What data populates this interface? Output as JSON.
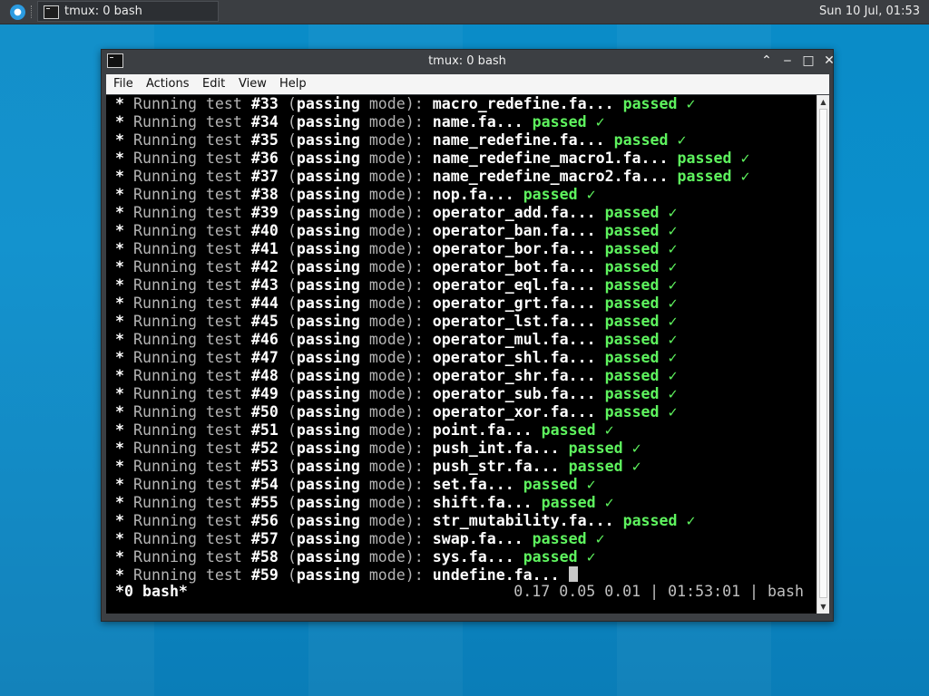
{
  "panel": {
    "task_label": "tmux: 0 bash",
    "clock": "Sun 10 Jul, 01:53",
    "logo_icon": "xfce-mouse-icon"
  },
  "window": {
    "title": "tmux: 0 bash",
    "menu": [
      "File",
      "Actions",
      "Edit",
      "View",
      "Help"
    ],
    "controls": [
      "⌃",
      "‒",
      "□",
      "✕"
    ]
  },
  "terminal": {
    "prefix": "Running test",
    "mode_open": "(",
    "mode_word1": "passing",
    "mode_word2": "mode",
    "mode_close": "):",
    "result": "passed",
    "check": "✓",
    "lines": [
      {
        "num": "#33",
        "file": "macro_redefine.fa...",
        "passed": true
      },
      {
        "num": "#34",
        "file": "name.fa...",
        "passed": true
      },
      {
        "num": "#35",
        "file": "name_redefine.fa...",
        "passed": true
      },
      {
        "num": "#36",
        "file": "name_redefine_macro1.fa...",
        "passed": true
      },
      {
        "num": "#37",
        "file": "name_redefine_macro2.fa...",
        "passed": true
      },
      {
        "num": "#38",
        "file": "nop.fa...",
        "passed": true
      },
      {
        "num": "#39",
        "file": "operator_add.fa...",
        "passed": true
      },
      {
        "num": "#40",
        "file": "operator_ban.fa...",
        "passed": true
      },
      {
        "num": "#41",
        "file": "operator_bor.fa...",
        "passed": true
      },
      {
        "num": "#42",
        "file": "operator_bot.fa...",
        "passed": true
      },
      {
        "num": "#43",
        "file": "operator_eql.fa...",
        "passed": true
      },
      {
        "num": "#44",
        "file": "operator_grt.fa...",
        "passed": true
      },
      {
        "num": "#45",
        "file": "operator_lst.fa...",
        "passed": true
      },
      {
        "num": "#46",
        "file": "operator_mul.fa...",
        "passed": true
      },
      {
        "num": "#47",
        "file": "operator_shl.fa...",
        "passed": true
      },
      {
        "num": "#48",
        "file": "operator_shr.fa...",
        "passed": true
      },
      {
        "num": "#49",
        "file": "operator_sub.fa...",
        "passed": true
      },
      {
        "num": "#50",
        "file": "operator_xor.fa...",
        "passed": true
      },
      {
        "num": "#51",
        "file": "point.fa...",
        "passed": true
      },
      {
        "num": "#52",
        "file": "push_int.fa...",
        "passed": true
      },
      {
        "num": "#53",
        "file": "push_str.fa...",
        "passed": true
      },
      {
        "num": "#54",
        "file": "set.fa...",
        "passed": true
      },
      {
        "num": "#55",
        "file": "shift.fa...",
        "passed": true
      },
      {
        "num": "#56",
        "file": "str_mutability.fa...",
        "passed": true
      },
      {
        "num": "#57",
        "file": "swap.fa...",
        "passed": true
      },
      {
        "num": "#58",
        "file": "sys.fa...",
        "passed": true
      },
      {
        "num": "#59",
        "file": "undefine.fa...",
        "passed": false
      }
    ],
    "status_left": "*0 bash*",
    "status_right": "0.17 0.05 0.01 | 01:53:01 | bash"
  },
  "colors": {
    "desktop": "#0a8bc7",
    "pass_green": "#5ef35e",
    "panel": "#3b3e42"
  }
}
